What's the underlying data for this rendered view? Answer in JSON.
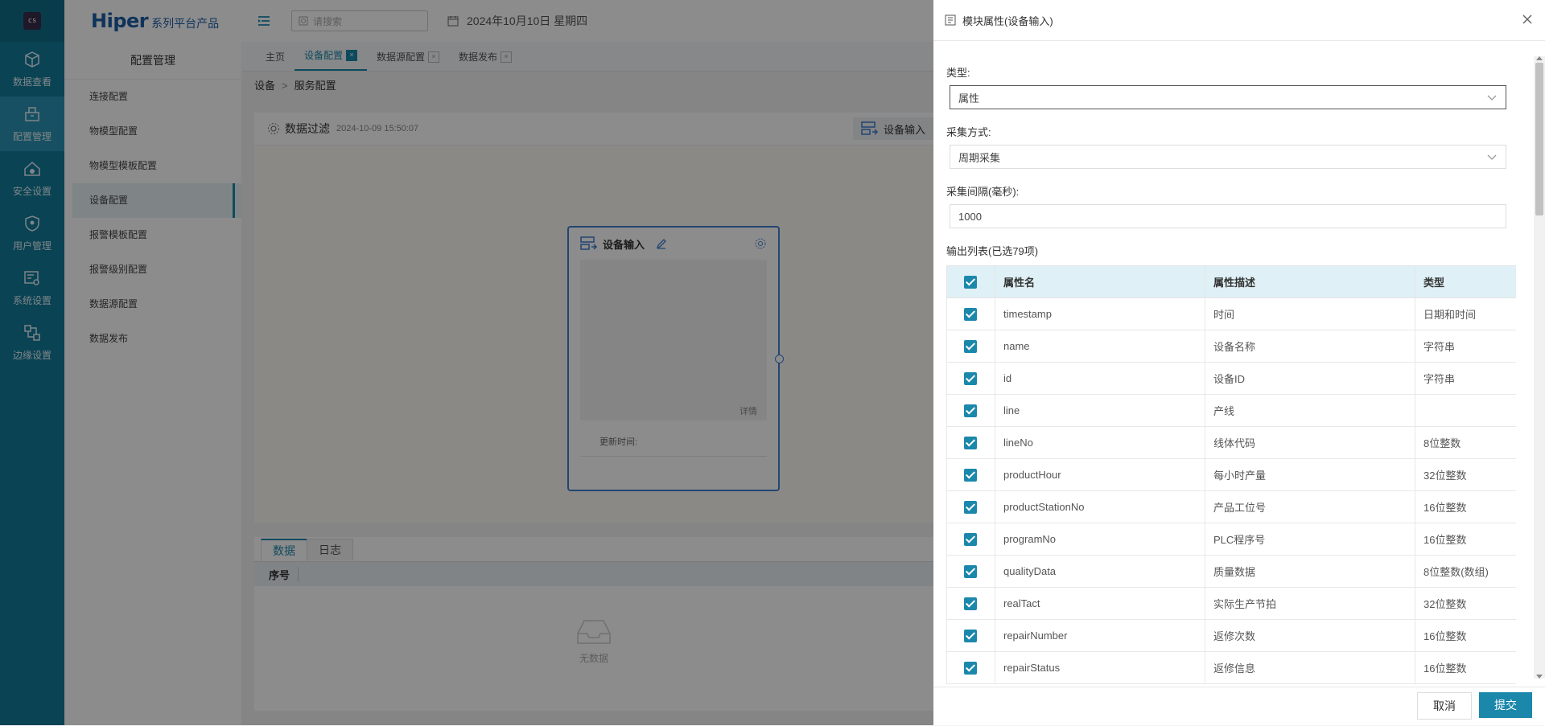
{
  "rail": {
    "items": [
      {
        "label": "数据查看",
        "icon": "cube-icon"
      },
      {
        "label": "配置管理",
        "icon": "config-icon",
        "active": true
      },
      {
        "label": "安全设置",
        "icon": "home-shield-icon"
      },
      {
        "label": "用户管理",
        "icon": "user-shield-icon"
      },
      {
        "label": "系统设置",
        "icon": "system-settings-icon"
      },
      {
        "label": "边缘设置",
        "icon": "edge-icon"
      }
    ]
  },
  "brand": {
    "name": "Hiper",
    "subtitle": "系列平台产品"
  },
  "sidebar": {
    "title": "配置管理",
    "items": [
      {
        "label": "连接配置"
      },
      {
        "label": "物模型配置"
      },
      {
        "label": "物模型模板配置"
      },
      {
        "label": "设备配置",
        "active": true
      },
      {
        "label": "报警模板配置"
      },
      {
        "label": "报警级别配置"
      },
      {
        "label": "数据源配置"
      },
      {
        "label": "数据发布"
      }
    ]
  },
  "topbar": {
    "search_placeholder": "请搜索",
    "date": "2024年10月10日 星期四"
  },
  "tabs": [
    {
      "label": "主页"
    },
    {
      "label": "设备配置",
      "active": true
    },
    {
      "label": "数据源配置"
    },
    {
      "label": "数据发布"
    }
  ],
  "breadcrumb": {
    "items": [
      "设备",
      "服务配置"
    ],
    "separator": ">"
  },
  "panel": {
    "title": "数据过滤",
    "datetime": "2024-10-09 15:50:07",
    "right_button": "设备输入"
  },
  "node": {
    "title": "设备输入",
    "detail": "详情",
    "update_label": "更新时间:"
  },
  "bottom": {
    "tabs": [
      {
        "label": "数据",
        "active": true
      },
      {
        "label": "日志"
      }
    ],
    "col_header": "序号",
    "empty_text": "无数据"
  },
  "drawer": {
    "title": "模块属性(设备输入)",
    "fields": {
      "type_label": "类型:",
      "type_value": "属性",
      "collect_label": "采集方式:",
      "collect_value": "周期采集",
      "interval_label": "采集间隔(毫秒):",
      "interval_value": "1000",
      "list_label": "输出列表(已选79项)"
    },
    "table": {
      "headers": [
        "属性名",
        "属性描述",
        "类型"
      ],
      "rows": [
        {
          "name": "timestamp",
          "desc": "时间",
          "type": "日期和时间"
        },
        {
          "name": "name",
          "desc": "设备名称",
          "type": "字符串"
        },
        {
          "name": "id",
          "desc": "设备ID",
          "type": "字符串"
        },
        {
          "name": "line",
          "desc": "产线",
          "type": ""
        },
        {
          "name": "lineNo",
          "desc": "线体代码",
          "type": "8位整数"
        },
        {
          "name": "productHour",
          "desc": "每小时产量",
          "type": "32位整数"
        },
        {
          "name": "productStationNo",
          "desc": "产品工位号",
          "type": "16位整数"
        },
        {
          "name": "programNo",
          "desc": "PLC程序号",
          "type": "16位整数"
        },
        {
          "name": "qualityData",
          "desc": "质量数据",
          "type": "8位整数(数组)"
        },
        {
          "name": "realTact",
          "desc": "实际生产节拍",
          "type": "32位整数"
        },
        {
          "name": "repairNumber",
          "desc": "返修次数",
          "type": "16位整数"
        },
        {
          "name": "repairStatus",
          "desc": "返修信息",
          "type": "16位整数"
        }
      ]
    },
    "cancel_label": "取消",
    "submit_label": "提交"
  },
  "colors": {
    "accent": "#1b88ab",
    "rail_bg": "#127a99",
    "rail_active": "#2a93b3",
    "node_border": "#3f7fd0"
  }
}
